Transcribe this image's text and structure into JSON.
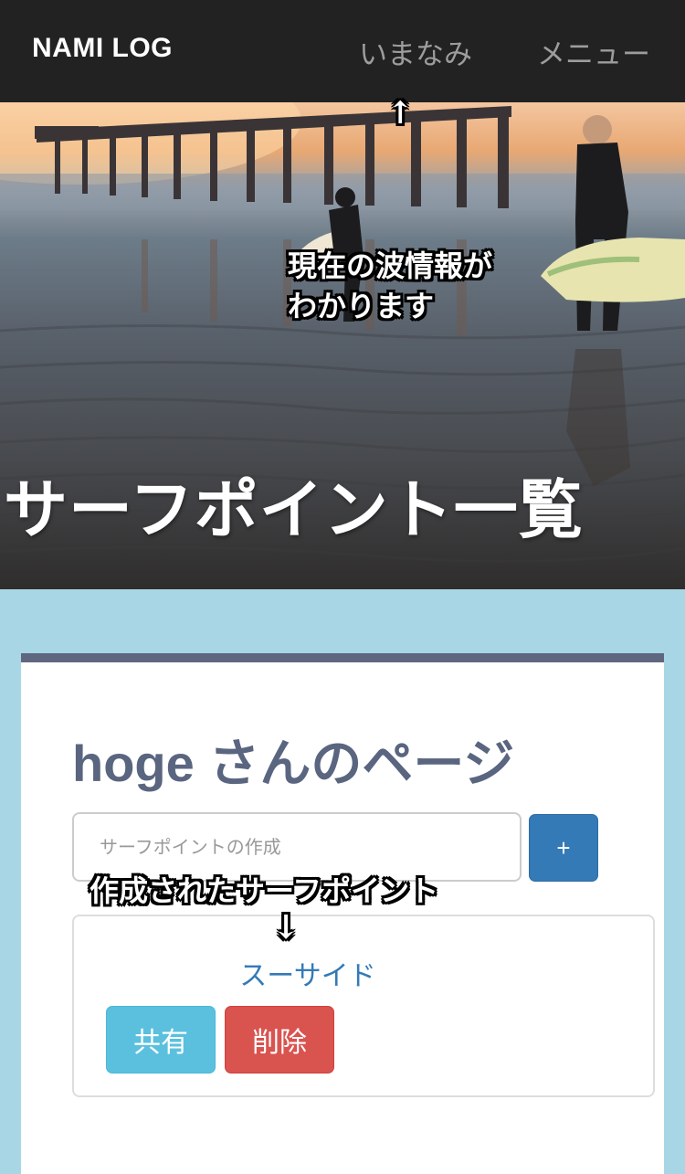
{
  "navbar": {
    "brand": "NAMI LOG",
    "links": [
      "いまなみ",
      "メニュー"
    ]
  },
  "hero": {
    "title": "サーフポイント一覧"
  },
  "annotations": {
    "arrow_up": "↑",
    "hero_note_line1": "現在の波情報が",
    "hero_note_line2": "わかります",
    "created_note": "作成されたサーフポイント",
    "arrow_down": "↓"
  },
  "page": {
    "title": "hoge さんのページ",
    "create_placeholder": "サーフポイントの作成",
    "add_label": "+"
  },
  "surf_points": [
    {
      "name": "スーサイド",
      "share_label": "共有",
      "delete_label": "削除"
    }
  ],
  "colors": {
    "navbar_bg": "#222222",
    "page_bg": "#a8d6e5",
    "card_top_border": "#5f6680",
    "primary": "#337ab7",
    "info": "#5bc0de",
    "danger": "#d9534f"
  }
}
